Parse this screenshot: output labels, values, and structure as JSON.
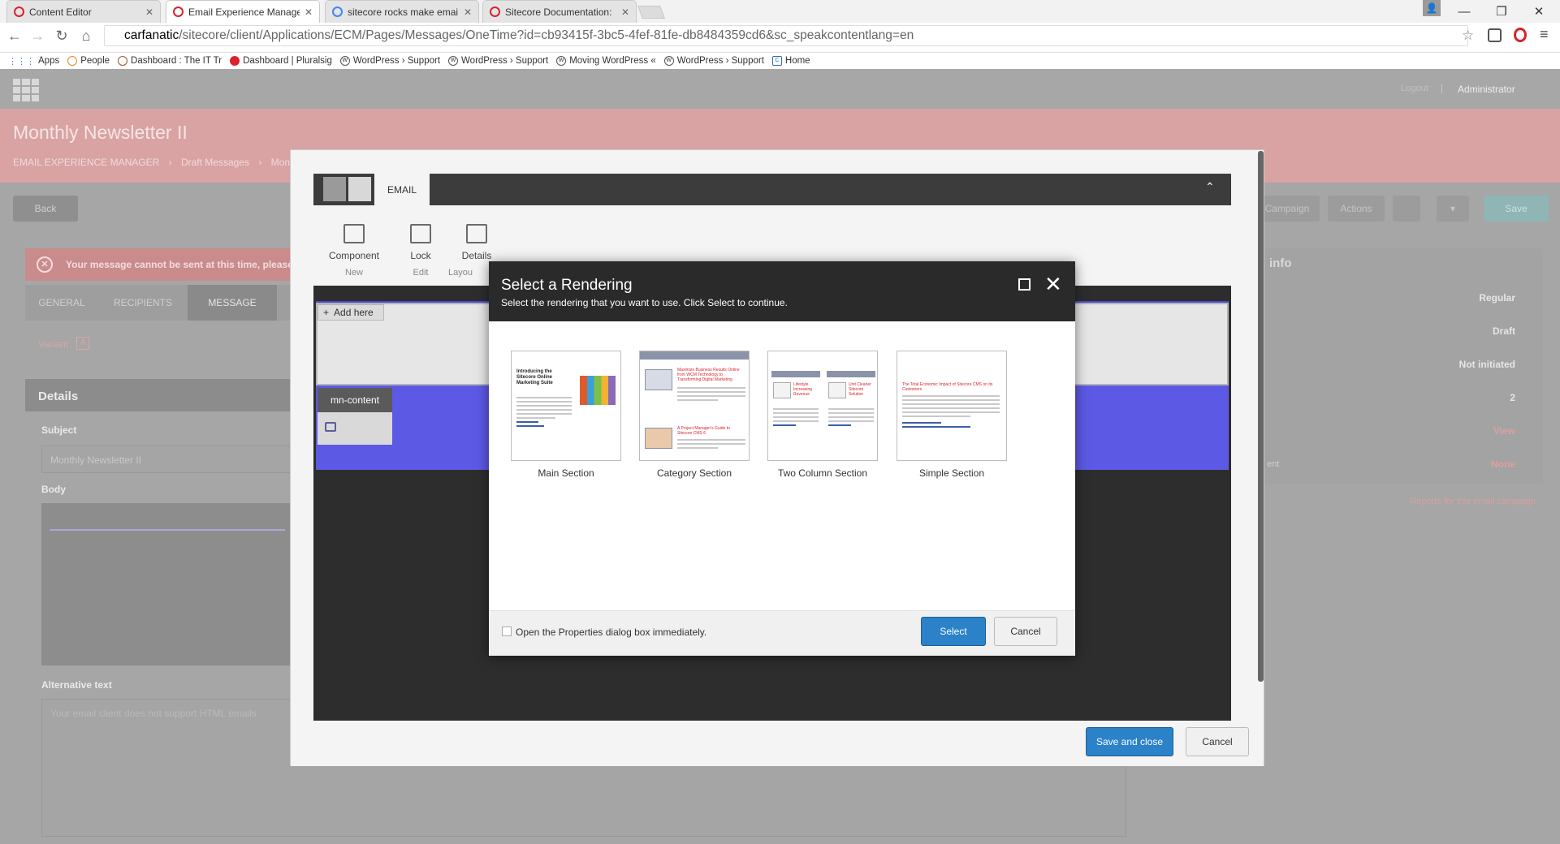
{
  "browser": {
    "tabs": [
      {
        "title": "Content Editor",
        "active": false
      },
      {
        "title": "Email Experience Manage",
        "active": true
      },
      {
        "title": "sitecore rocks make emai",
        "active": false
      },
      {
        "title": "Sitecore Documentation: ",
        "active": false
      }
    ],
    "url_host": "carfanatic",
    "url_path": "/sitecore/client/Applications/ECM/Pages/Messages/OneTime?id=cb93415f-3bc5-4fef-81fe-db8484359cd6&sc_speakcontentlang=en",
    "bookmarks": [
      "Apps",
      "People",
      "Dashboard : The IT Tr",
      "Dashboard | Pluralsig",
      "WordPress › Support",
      "WordPress › Support",
      "Moving WordPress «",
      "WordPress › Support",
      "Home"
    ]
  },
  "topbar": {
    "logout": "Logout",
    "separator": "|",
    "user": "Administrator"
  },
  "header": {
    "title": "Monthly Newsletter II",
    "breadcrumb": [
      "EMAIL EXPERIENCE MANAGER",
      "Draft Messages",
      "Mon"
    ]
  },
  "actions": {
    "back": "Back",
    "campaign": "Campaign",
    "actions_label": "Actions",
    "save": "Save"
  },
  "error": {
    "text": "Your message cannot be sent at this time, please"
  },
  "steps": [
    "GENERAL",
    "RECIPIENTS",
    "MESSAGE"
  ],
  "variant": {
    "label": "Variant",
    "value": "A"
  },
  "details": {
    "heading": "Details",
    "subject_label": "Subject",
    "subject_value": "Monthly Newsletter II",
    "body_label": "Body",
    "alt_label": "Alternative text",
    "alt_placeholder": "Your email client does not support HTML emails"
  },
  "info_panel": {
    "heading": "info",
    "values": [
      "Regular",
      "Draft",
      "Not initiated",
      "2",
      "View",
      "None"
    ],
    "partial_label": "ent",
    "reports_link": "Reports for this email campaign"
  },
  "editor": {
    "ribbon_tab": "EMAIL",
    "buttons": [
      {
        "label": "Component",
        "group": "New",
        "icon": "component-icon"
      },
      {
        "label": "Lock",
        "group": "Edit",
        "icon": "lock-icon"
      },
      {
        "label": "Details",
        "group": "Layou",
        "icon": "details-icon"
      }
    ],
    "add_here": "Add here",
    "mn_content": "mn-content",
    "save_close": "Save and close",
    "cancel": "Cancel"
  },
  "dialog": {
    "title": "Select a Rendering",
    "subtitle": "Select the rendering that you want to use. Click Select to continue.",
    "renderings": [
      {
        "name": "Main Section",
        "thumb_title": "Introducing the Sitecore Online Marketing Suite"
      },
      {
        "name": "Category Section",
        "thumb_title": "Maximize Business Results Online from WCM Technology to Transforming Digital Marketing",
        "thumb_title2": "A Project Manager's Guide to Sitecore CMS 6"
      },
      {
        "name": "Two Column Section",
        "thumb_title": "Lifestyle Increasing Revenue",
        "thumb_title2": "Unit Cleaner Sitecore Solution"
      },
      {
        "name": "Simple Section",
        "thumb_title": "The Total Economic Impact of Sitecore CMS on its Customers"
      }
    ],
    "checkbox_label": "Open the Properties dialog box immediately.",
    "select": "Select",
    "cancel": "Cancel"
  },
  "colors": {
    "accent_blue": "#2b82c8",
    "band_blue": "#5c59e5",
    "header_red": "#d9a3a3"
  }
}
